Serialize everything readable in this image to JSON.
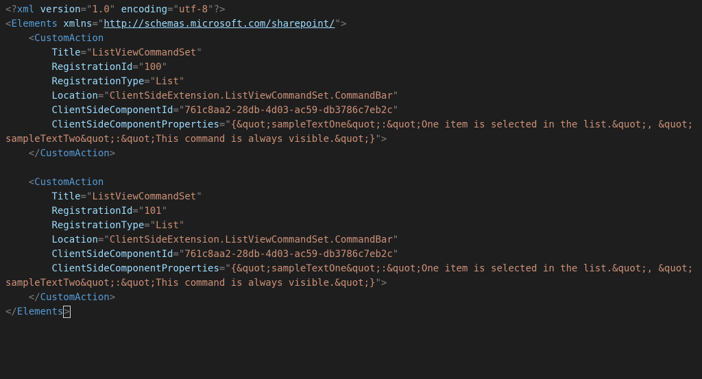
{
  "xml_declaration": {
    "version": "1.0",
    "encoding": "utf-8"
  },
  "root": {
    "name": "Elements",
    "xmlns": "http://schemas.microsoft.com/sharepoint/"
  },
  "customActions": [
    {
      "Title": "ListViewCommandSet",
      "RegistrationId": "100",
      "RegistrationType": "List",
      "Location": "ClientSideExtension.ListViewCommandSet.CommandBar",
      "ClientSideComponentId": "761c8aa2-28db-4d03-ac59-db3786c7eb2c",
      "ClientSideComponentProperties": "{&quot;sampleTextOne&quot;:&quot;One item is selected in the list.&quot;, &quot;sampleTextTwo&quot;:&quot;This command is always visible.&quot;}"
    },
    {
      "Title": "ListViewCommandSet",
      "RegistrationId": "101",
      "RegistrationType": "List",
      "Location": "ClientSideExtension.ListViewCommandSet.CommandBar",
      "ClientSideComponentId": "761c8aa2-28db-4d03-ac59-db3786c7eb2c",
      "ClientSideComponentProperties": "{&quot;sampleTextOne&quot;:&quot;One item is selected in the list.&quot;, &quot;sampleTextTwo&quot;:&quot;This command is always visible.&quot;}"
    }
  ]
}
